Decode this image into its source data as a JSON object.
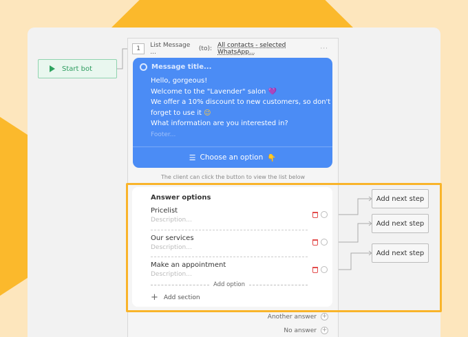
{
  "start_node": {
    "label": "Start bot",
    "icon": "play-icon"
  },
  "message_node": {
    "step_number": "1",
    "type_label": "List Message ...",
    "to_label": "(to):",
    "recipient": "All contacts - selected WhatsApp...",
    "more": "···",
    "title_placeholder": "Message title...",
    "body_lines": [
      "Hello, gorgeous!",
      "Welcome to the \"Lavender\" salon",
      "We offer a 10% discount to new customers, so don't",
      "forget to use it",
      "What information are you interested in?"
    ],
    "emoji_heart": "💜",
    "emoji_smile": "😉",
    "footer_placeholder": "Footer...",
    "choose_label": "Choose an option",
    "emoji_point": "👇",
    "hint": "The client can click the button to view the list below"
  },
  "answer_options": {
    "title": "Answer options",
    "options": [
      {
        "label": "Pricelist",
        "description": "Description..."
      },
      {
        "label": "Our services",
        "description": "Description..."
      },
      {
        "label": "Make an appointment",
        "description": "Description..."
      }
    ],
    "add_option": "Add option",
    "add_section": "Add section"
  },
  "next_steps": [
    "Add next step",
    "Add next step",
    "Add next step"
  ],
  "footer_actions": {
    "another_answer": "Another answer",
    "no_answer": "No answer"
  },
  "colors": {
    "message_bubble": "#4b8cf5",
    "highlight": "#f9b42a",
    "start_green": "#2ea35f",
    "delete_red": "#e34b4b"
  }
}
